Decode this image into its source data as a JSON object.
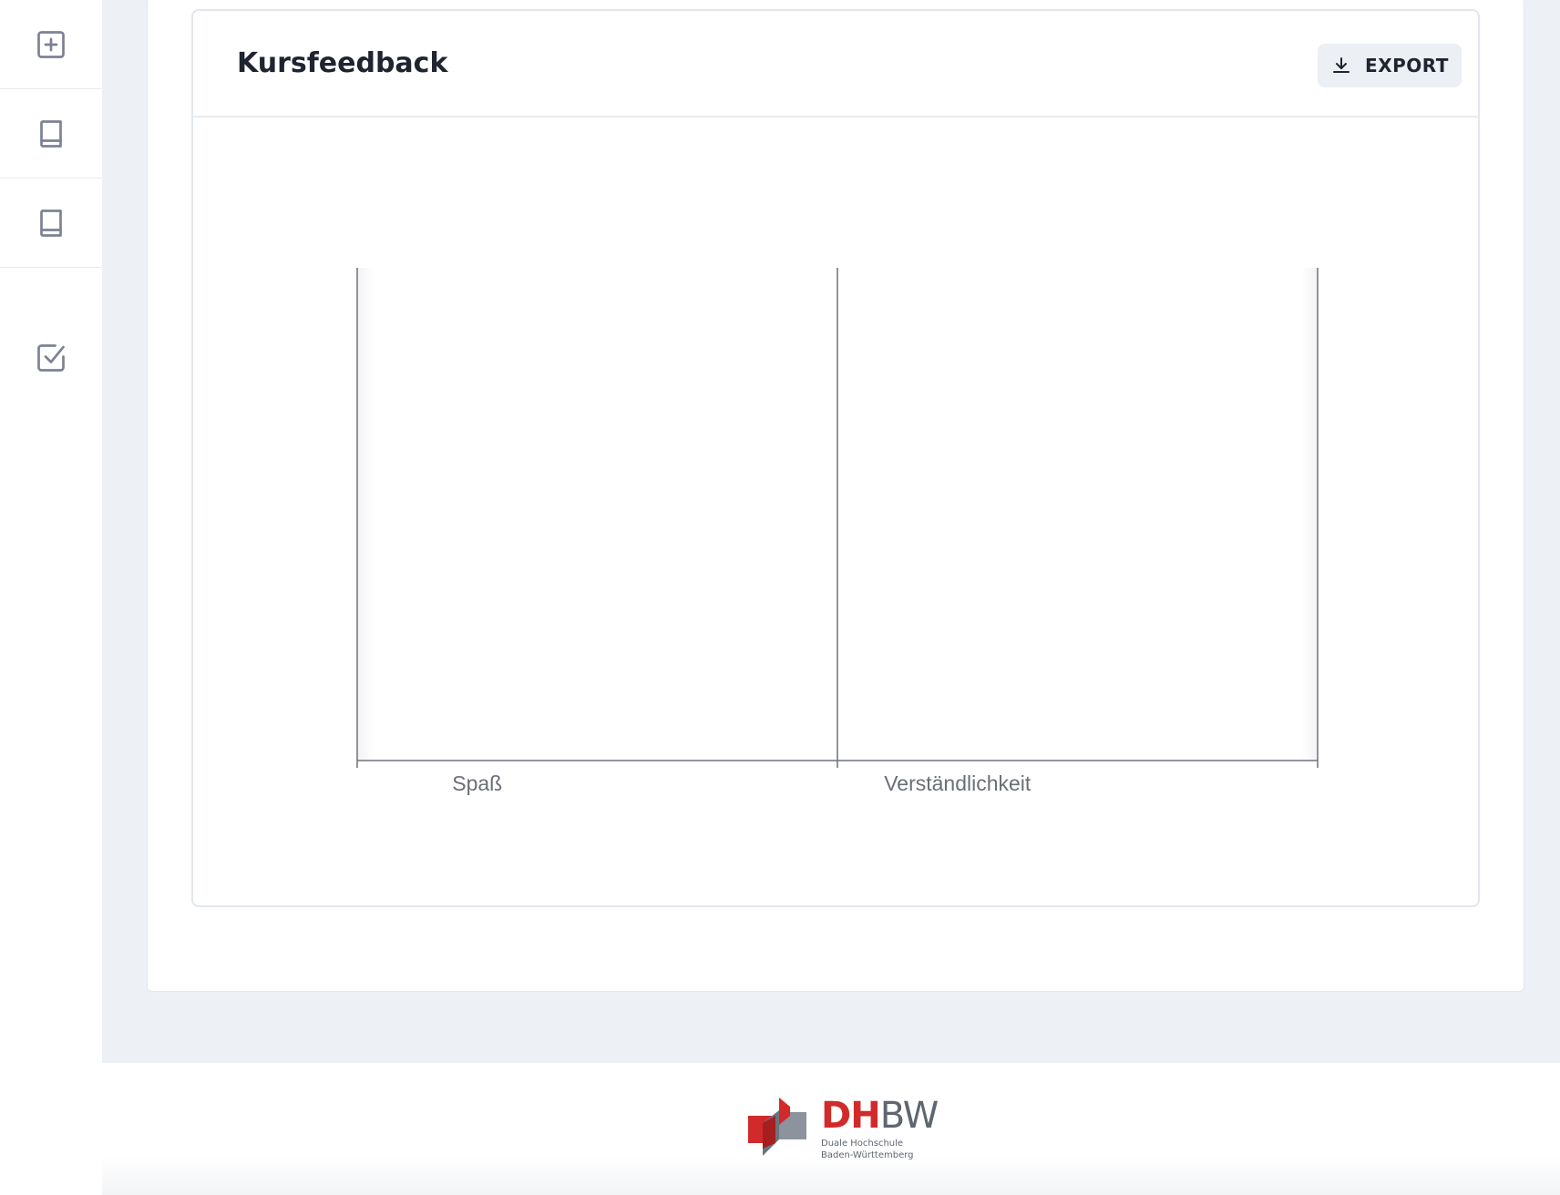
{
  "sidebar": {
    "items": [
      {
        "icon": "plus-square-icon"
      },
      {
        "icon": "book-icon"
      },
      {
        "icon": "book-icon"
      },
      {
        "icon": "check-square-icon"
      }
    ]
  },
  "card": {
    "title": "Kursfeedback",
    "export_label": "EXPORT",
    "export_icon": "download-icon"
  },
  "chart_data": {
    "type": "bar",
    "categories": [
      "Spaß",
      "Verständlichkeit"
    ],
    "series": [],
    "title": "",
    "xlabel": "",
    "ylabel": "",
    "grid": false,
    "legend": "none"
  },
  "footer": {
    "logo_dh": "DH",
    "logo_bw": "BW",
    "logo_line1": "Duale Hochschule",
    "logo_line2": "Baden-Württemberg"
  },
  "colors": {
    "accent_red": "#d22a2a",
    "logo_grey": "#5f6670",
    "axis": "#6e7180",
    "background": "#edf0f5"
  }
}
